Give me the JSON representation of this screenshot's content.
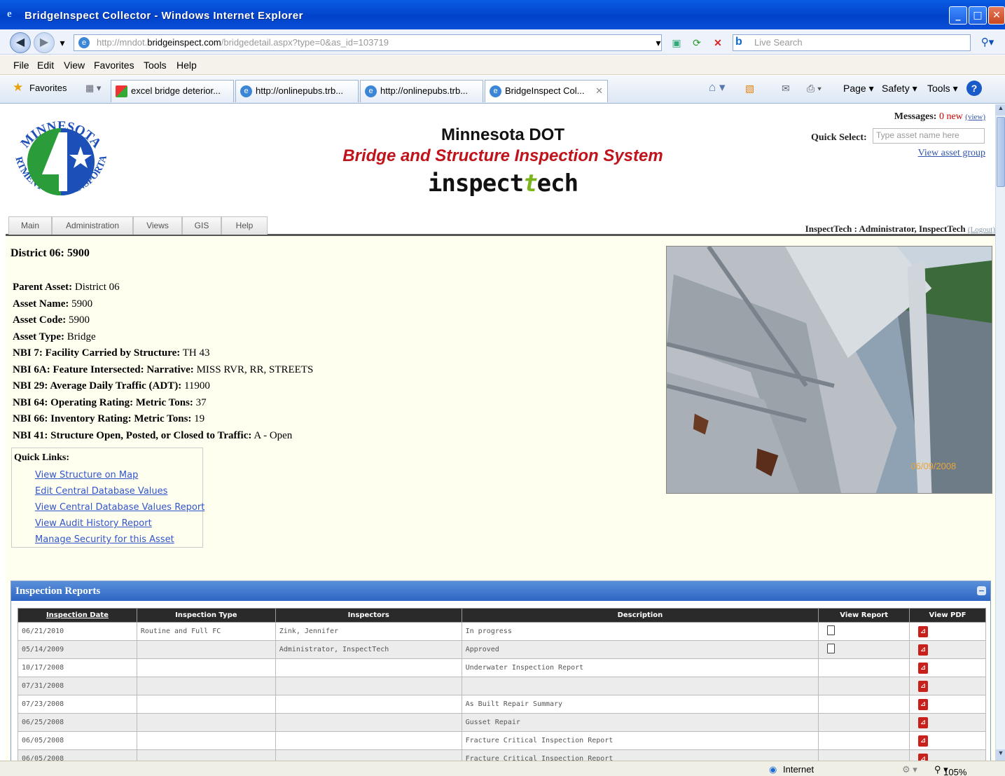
{
  "window": {
    "title": "BridgeInspect Collector - Windows Internet Explorer"
  },
  "address": {
    "url_prefix": "http://mndot.",
    "url_domain": "bridgeinspect.com",
    "url_path": "/bridgedetail.aspx?type=0&as_id=103719",
    "search_placeholder": "Live Search"
  },
  "menu": [
    "File",
    "Edit",
    "View",
    "Favorites",
    "Tools",
    "Help"
  ],
  "favorites": {
    "label": "Favorites",
    "tabs": [
      {
        "label": "excel bridge deterior..."
      },
      {
        "label": "http://onlinepubs.trb..."
      },
      {
        "label": "http://onlinepubs.trb..."
      },
      {
        "label": "BridgeInspect Col..."
      }
    ],
    "commands": [
      "Page",
      "Safety",
      "Tools"
    ]
  },
  "header": {
    "logo_text_top": "MINNESOTA",
    "logo_text_bottom": "DEPARTMENT OF TRANSPORTATION",
    "title": "Minnesota DOT",
    "subtitle": "Bridge and Structure Inspection System",
    "brand_part1": "inspect",
    "brand_t": "t",
    "brand_part2": "ech",
    "messages_label": "Messages:",
    "messages_new": "0 new",
    "messages_view": "(view)",
    "quick_select_label": "Quick Select:",
    "quick_select_placeholder": "Type asset name here",
    "view_asset_group": "View asset group",
    "user": "InspectTech : Administrator, InspectTech",
    "logout": "(Logout)"
  },
  "nav_tabs": [
    "Main",
    "Administration",
    "Views",
    "GIS",
    "Help"
  ],
  "asset": {
    "heading": "District 06: 5900",
    "properties": [
      {
        "label": "Parent Asset:",
        "value": "District 06"
      },
      {
        "label": "Asset Name:",
        "value": "5900"
      },
      {
        "label": "Asset Code:",
        "value": "5900"
      },
      {
        "label": "Asset Type:",
        "value": "Bridge"
      },
      {
        "label": "NBI 7: Facility Carried by Structure:",
        "value": "TH 43"
      },
      {
        "label": "NBI 6A: Feature Intersected: Narrative:",
        "value": "MISS RVR, RR, STREETS"
      },
      {
        "label": "NBI 29: Average Daily Traffic (ADT):",
        "value": "11900"
      },
      {
        "label": "NBI 64: Operating Rating: Metric Tons:",
        "value": "37"
      },
      {
        "label": "NBI 66: Inventory Rating: Metric Tons:",
        "value": "19"
      },
      {
        "label": "NBI 41: Structure Open, Posted, or Closed to Traffic:",
        "value": "A - Open"
      }
    ],
    "photo_date": "06/09/2008"
  },
  "quick_links": {
    "title": "Quick Links:",
    "links": [
      "View Structure on Map",
      "Edit Central Database Values",
      "View Central Database Values Report",
      "View Audit History Report",
      "Manage Security for this Asset"
    ]
  },
  "reports": {
    "title": "Inspection Reports",
    "columns": [
      "Inspection Date",
      "Inspection Type",
      "Inspectors",
      "Description",
      "View Report",
      "View PDF"
    ],
    "rows": [
      {
        "date": "06/21/2010",
        "type": "Routine and Full FC",
        "inspectors": "Zink, Jennifer",
        "description": "In progress",
        "report": true,
        "pdf": true
      },
      {
        "date": "05/14/2009",
        "type": "",
        "inspectors": "Administrator, InspectTech",
        "description": "Approved",
        "report": true,
        "pdf": true
      },
      {
        "date": "10/17/2008",
        "type": "",
        "inspectors": "",
        "description": "Underwater Inspection Report",
        "report": false,
        "pdf": true
      },
      {
        "date": "07/31/2008",
        "type": "",
        "inspectors": "",
        "description": "",
        "report": false,
        "pdf": true
      },
      {
        "date": "07/23/2008",
        "type": "",
        "inspectors": "",
        "description": "As Built Repair Summary",
        "report": false,
        "pdf": true
      },
      {
        "date": "06/25/2008",
        "type": "",
        "inspectors": "",
        "description": "Gusset Repair",
        "report": false,
        "pdf": true
      },
      {
        "date": "06/05/2008",
        "type": "",
        "inspectors": "",
        "description": "Fracture Critical Inspection Report",
        "report": false,
        "pdf": true
      },
      {
        "date": "06/05/2008",
        "type": "",
        "inspectors": "",
        "description": "Fracture Critical Inspection Report",
        "report": false,
        "pdf": true
      }
    ]
  },
  "status": {
    "zone": "Internet",
    "zoom": "105%"
  }
}
